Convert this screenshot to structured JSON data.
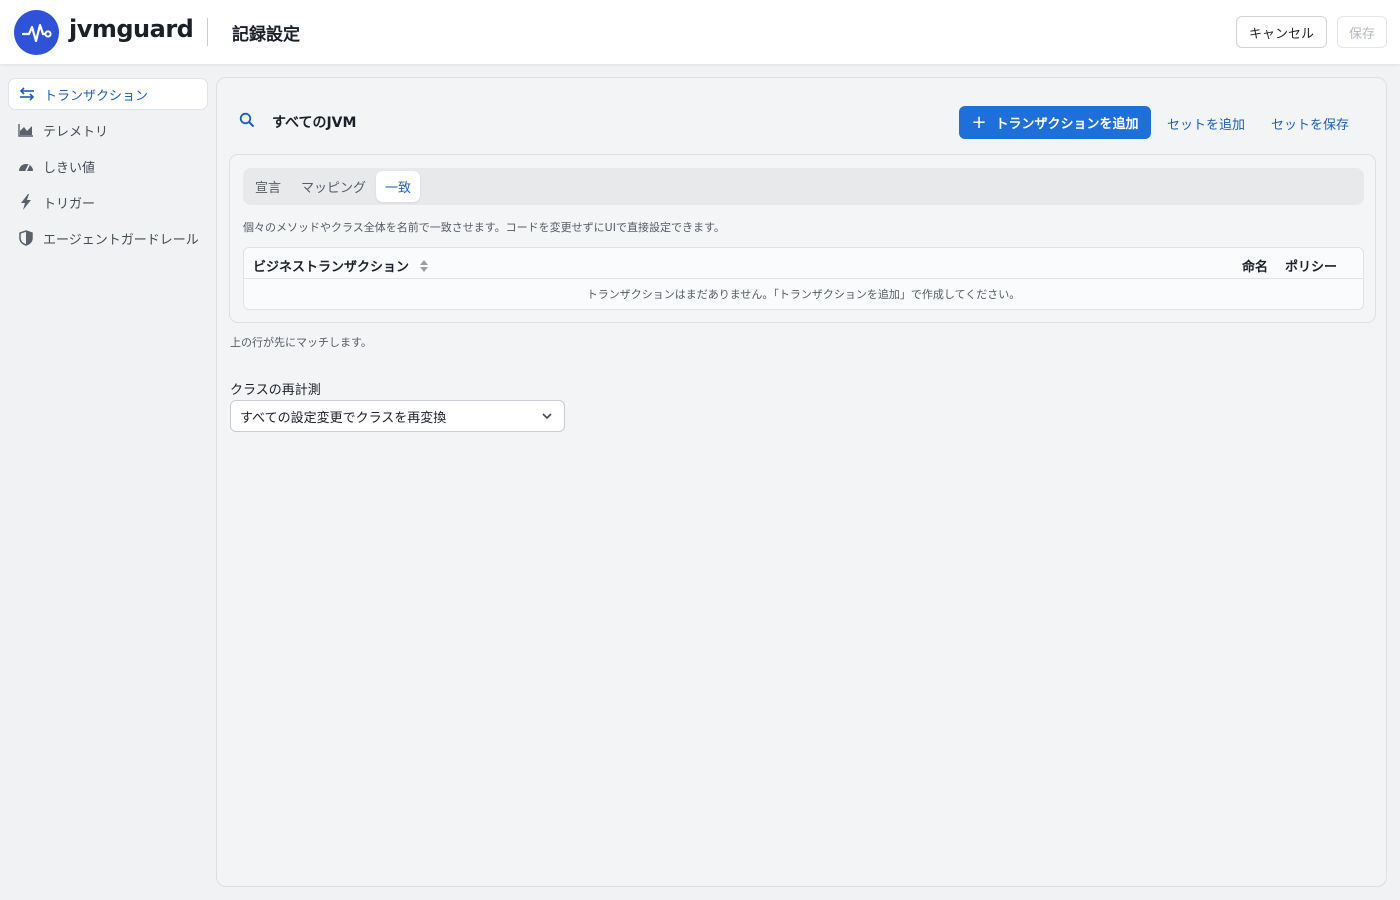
{
  "header": {
    "brand": "jvmguard",
    "title": "記録設定",
    "cancel_label": "キャンセル",
    "save_label": "保存"
  },
  "sidebar": {
    "items": [
      {
        "label": "トランザクション",
        "icon": "arrows-swap-icon",
        "active": true
      },
      {
        "label": "テレメトリ",
        "icon": "area-chart-icon",
        "active": false
      },
      {
        "label": "しきい値",
        "icon": "gauge-icon",
        "active": false
      },
      {
        "label": "トリガー",
        "icon": "lightning-icon",
        "active": false
      },
      {
        "label": "エージェントガードレール",
        "icon": "shield-icon",
        "active": false
      }
    ]
  },
  "main": {
    "scope_title": "すべてのJVM",
    "add_transaction_label": "トランザクションを追加",
    "add_set_label": "セットを追加",
    "save_set_label": "セットを保存",
    "tabs": [
      {
        "label": "宣言",
        "active": false
      },
      {
        "label": "マッピング",
        "active": false
      },
      {
        "label": "一致",
        "active": true
      }
    ],
    "description": "個々のメソッドやクラス全体を名前で一致させます。コードを変更せずにUIで直接設定できます。",
    "table": {
      "columns": [
        "ビジネストランザクション",
        "命名",
        "ポリシー"
      ],
      "empty_message": "トランザクションはまだありません。「トランザクションを追加」で作成してください。"
    },
    "order_note": "上の行が先にマッチします。",
    "retransform": {
      "label": "クラスの再計測",
      "selected": "すべての設定変更でクラスを再変換"
    }
  },
  "colors": {
    "accent": "#1e6fd9",
    "brand": "#2f53d8",
    "link": "#1d5fb8"
  }
}
